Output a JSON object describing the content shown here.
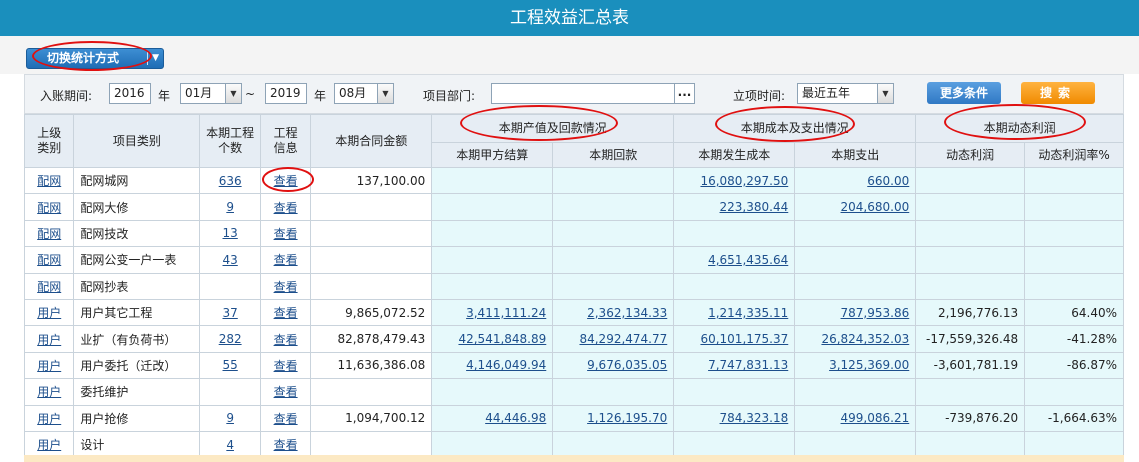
{
  "title": "工程效益汇总表",
  "toolbar": {
    "switch_label": "切换统计方式"
  },
  "filters": {
    "period_label": "入账期间:",
    "year_from": "2016",
    "year_label_1": "年",
    "month_from": "01月",
    "range_sep": "~",
    "year_to": "2019",
    "year_label_2": "年",
    "month_to": "08月",
    "dept_label": "项目部门:",
    "dept_value": "",
    "dots_label": "...",
    "setup_label": "立项时间:",
    "setup_value": "最近五年",
    "more_label": "更多条件",
    "search_label": "搜索"
  },
  "table": {
    "headers": {
      "upper_category": "上级类别",
      "project_category": "项目类别",
      "project_count": "本期工程个数",
      "project_info": "工程信息",
      "contract_amount": "本期合同金额",
      "group_output": "本期产值及回款情况",
      "group_cost": "本期成本及支出情况",
      "group_profit": "本期动态利润",
      "party_a_settlement": "本期甲方结算",
      "payment_received": "本期回款",
      "cost_incurred": "本期发生成本",
      "expenditure": "本期支出",
      "dynamic_profit": "动态利润",
      "dynamic_profit_rate": "动态利润率%"
    },
    "rows": [
      {
        "upper": "配网",
        "category": "配网城网",
        "count": "636",
        "view": "查看",
        "contract": "137,100.00",
        "settlement": "",
        "received": "",
        "cost": "16,080,297.50",
        "expense": "660.00",
        "profit": "",
        "rate": ""
      },
      {
        "upper": "配网",
        "category": "配网大修",
        "count": "9",
        "view": "查看",
        "contract": "",
        "settlement": "",
        "received": "",
        "cost": "223,380.44",
        "expense": "204,680.00",
        "profit": "",
        "rate": ""
      },
      {
        "upper": "配网",
        "category": "配网技改",
        "count": "13",
        "view": "查看",
        "contract": "",
        "settlement": "",
        "received": "",
        "cost": "",
        "expense": "",
        "profit": "",
        "rate": ""
      },
      {
        "upper": "配网",
        "category": "配网公变一户一表",
        "count": "43",
        "view": "查看",
        "contract": "",
        "settlement": "",
        "received": "",
        "cost": "4,651,435.64",
        "expense": "",
        "profit": "",
        "rate": ""
      },
      {
        "upper": "配网",
        "category": "配网抄表",
        "count": "",
        "view": "查看",
        "contract": "",
        "settlement": "",
        "received": "",
        "cost": "",
        "expense": "",
        "profit": "",
        "rate": ""
      },
      {
        "upper": "用户",
        "category": "用户其它工程",
        "count": "37",
        "view": "查看",
        "contract": "9,865,072.52",
        "settlement": "3,411,111.24",
        "received": "2,362,134.33",
        "cost": "1,214,335.11",
        "expense": "787,953.86",
        "profit": "2,196,776.13",
        "rate": "64.40%"
      },
      {
        "upper": "用户",
        "category": "业扩（有负荷书）",
        "count": "282",
        "view": "查看",
        "contract": "82,878,479.43",
        "settlement": "42,541,848.89",
        "received": "84,292,474.77",
        "cost": "60,101,175.37",
        "expense": "26,824,352.03",
        "profit": "-17,559,326.48",
        "rate": "-41.28%"
      },
      {
        "upper": "用户",
        "category": "用户委托（迁改）",
        "count": "55",
        "view": "查看",
        "contract": "11,636,386.08",
        "settlement": "4,146,049.94",
        "received": "9,676,035.05",
        "cost": "7,747,831.13",
        "expense": "3,125,369.00",
        "profit": "-3,601,781.19",
        "rate": "-86.87%"
      },
      {
        "upper": "用户",
        "category": "委托维护",
        "count": "",
        "view": "查看",
        "contract": "",
        "settlement": "",
        "received": "",
        "cost": "",
        "expense": "",
        "profit": "",
        "rate": ""
      },
      {
        "upper": "用户",
        "category": "用户抢修",
        "count": "9",
        "view": "查看",
        "contract": "1,094,700.12",
        "settlement": "44,446.98",
        "received": "1,126,195.70",
        "cost": "784,323.18",
        "expense": "499,086.21",
        "profit": "-739,876.20",
        "rate": "-1,664.63%"
      },
      {
        "upper": "用户",
        "category": "设计",
        "count": "4",
        "view": "查看",
        "contract": "",
        "settlement": "",
        "received": "",
        "cost": "",
        "expense": "",
        "profit": "",
        "rate": ""
      }
    ]
  },
  "colors": {
    "title_bar": "#1a8fbd",
    "link": "#1d4f8c",
    "annotation": "#e01010",
    "search_button": "#f08a00",
    "more_button": "#2f78c4",
    "data_cell": "#e6f9fb"
  }
}
